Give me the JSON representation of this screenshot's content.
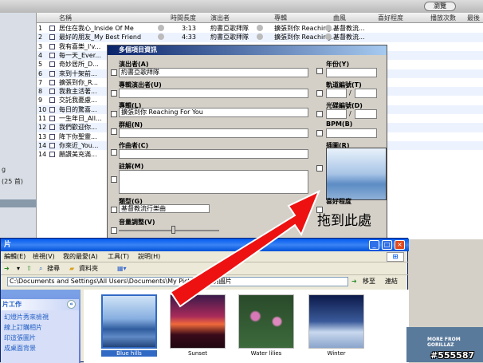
{
  "itunes": {
    "browse_label": "瀏覽",
    "columns": [
      "名稱",
      "時間長度",
      "演出者",
      "專輯",
      "曲風",
      "喜好程度",
      "播放次數",
      "最後"
    ],
    "rows": [
      {
        "num": "1",
        "name": "居住在我心_Inside Of Me",
        "time": "3:13",
        "artist": "約書亞歌拜隊",
        "album": "擴張到你 Reaching...",
        "genre": "基督教流..."
      },
      {
        "num": "2",
        "name": "最好的朋友_My Best Friend",
        "time": "4:33",
        "artist": "約書亞歌拜隊",
        "album": "擴張到你 Reaching...",
        "genre": "基督教流..."
      },
      {
        "num": "3",
        "name": "我有喜樂_I'v...",
        "time": "",
        "artist": "",
        "album": "",
        "genre": ""
      },
      {
        "num": "4",
        "name": "每一天_Ever...",
        "time": "",
        "artist": "",
        "album": "",
        "genre": ""
      },
      {
        "num": "5",
        "name": "奇妙居所_D...",
        "time": "",
        "artist": "",
        "album": "",
        "genre": ""
      },
      {
        "num": "6",
        "name": "來到十架前...",
        "time": "",
        "artist": "",
        "album": "",
        "genre": ""
      },
      {
        "num": "7",
        "name": "擴張到你_R...",
        "time": "",
        "artist": "",
        "album": "",
        "genre": ""
      },
      {
        "num": "8",
        "name": "我救主活著...",
        "time": "",
        "artist": "",
        "album": "",
        "genre": ""
      },
      {
        "num": "9",
        "name": "交託我憂慮...",
        "time": "",
        "artist": "",
        "album": "",
        "genre": ""
      },
      {
        "num": "10",
        "name": "每日的驚喜...",
        "time": "",
        "artist": "",
        "album": "",
        "genre": ""
      },
      {
        "num": "11",
        "name": "一生年日_All...",
        "time": "",
        "artist": "",
        "album": "",
        "genre": ""
      },
      {
        "num": "12",
        "name": "我們歡迎你...",
        "time": "",
        "artist": "",
        "album": "",
        "genre": ""
      },
      {
        "num": "13",
        "name": "降下你聖靈...",
        "time": "",
        "artist": "",
        "album": "",
        "genre": ""
      },
      {
        "num": "14",
        "name": "你來近_You...",
        "time": "",
        "artist": "",
        "album": "",
        "genre": ""
      },
      {
        "num": "14",
        "name": "願讚美充滿...",
        "time": "",
        "artist": "",
        "album": "",
        "genre": ""
      }
    ],
    "left_labels": [
      "g",
      "(25 首)"
    ]
  },
  "dialog": {
    "title": "多個項目資訊",
    "artist_label": "演出者(A)",
    "artist_value": "約書亞歌拜隊",
    "album_artist_label": "專輯演出者(U)",
    "album_label": "專輯(L)",
    "album_value": "擴張到你 Reaching For You",
    "grouping_label": "群組(N)",
    "composer_label": "作曲者(C)",
    "comment_label": "註解(M)",
    "genre_label": "類型(G)",
    "genre_value": "基督教流行樂曲",
    "volume_label": "音量調整(V)",
    "year_label": "年份(Y)",
    "track_label": "軌道編號(T)",
    "disc_label": "光碟編號(D)",
    "bpm_label": "BPM(B)",
    "artwork_label": "插圖(R)",
    "rating_label": "喜好程度",
    "slash": "/"
  },
  "drag_hint": "拖到此處",
  "explorer": {
    "title": "片",
    "menu": [
      "編輯(E)",
      "檢視(V)",
      "我的最愛(A)",
      "工具(T)",
      "說明(H)"
    ],
    "toolbar": [
      "搜尋",
      "資料夾"
    ],
    "address": "C:\\Documents and Settings\\All Users\\Documents\\My Pictures\\範例圖片",
    "go_label": "移至",
    "links_label": "連結",
    "task_header": "片工作",
    "tasks": [
      "幻燈片秀來檢視",
      "線上訂購相片",
      "印這張圖片",
      "成桌面背景"
    ],
    "thumbs": [
      "Blue hills",
      "Sunset",
      "Water lilies",
      "Winter"
    ]
  },
  "album_promo": "MORE FROM GORILLAZ",
  "watermark": "#555587",
  "colors": {
    "title_blue": "#0058ee",
    "arrow_red": "#ee1111",
    "selection": "#0a246a"
  }
}
